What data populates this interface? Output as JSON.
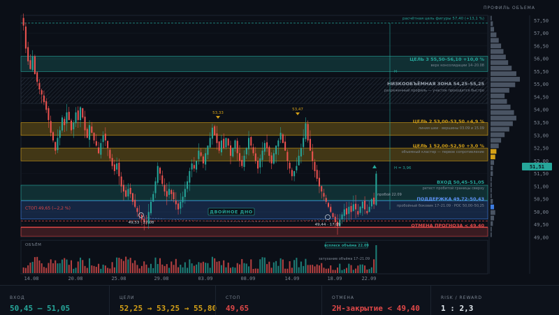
{
  "header": {
    "profile_title": "ПРОФИЛЬ ОБЪЕМА"
  },
  "colors": {
    "bull": "#26a69a",
    "bear": "#ef5350",
    "target": "#d4a017",
    "entry": "#26a69a",
    "support": "#3d7be0",
    "stop": "#e04848",
    "current_price": "#26a69a"
  },
  "y_axis": {
    "ticks": [
      "57,50",
      "57,00",
      "56,50",
      "56,00",
      "55,50",
      "55,00",
      "54,50",
      "54,00",
      "53,50",
      "53,00",
      "52,50",
      "52,00",
      "51,50",
      "51,00",
      "50,50",
      "50,00",
      "49,50",
      "49,00"
    ],
    "current_price_label": "51,51"
  },
  "x_axis": {
    "ticks": [
      "14.08",
      "20.08",
      "25.08",
      "29.08",
      "03.09",
      "08.09",
      "14.09",
      "18.09",
      "22.09"
    ]
  },
  "zones": {
    "target_figure": "расчётная цель фигуры 57,40 (+13,1 %)",
    "target3_title": "ЦЕЛЬ 3 55,50–56,10 +10,0 %",
    "target3_sub": "верх консолидации 14–20.08",
    "lowvol_title": "НИЗКООБЪЁМНАЯ ЗОНА 54,25–55,25",
    "lowvol_sub": "разреженный профиль — участок проходится быстро",
    "target2_title": "ЦЕЛЬ 2 53,00–53,50 +4,9 %",
    "target2_sub": "линия шеи · вершины 03.09 и 15.09",
    "target1_title": "ЦЕЛЬ 1 52,00–52,50 +3,0 %",
    "target1_sub": "объемный кластер — первое сопротивление",
    "entry_title": "ВХОД 50,45–51,05",
    "entry_sub": "ретест пробитой границы сверху",
    "support_title": "ПОДДЕРЖКА 49,72–50,43",
    "support_sub": "пробойный боковик 17–21.09 · POC 50,00–50,25",
    "stop_label": "СТОП 49,65 (−2,2 %)",
    "cancel_label": "ОТМЕНА ПРОГНОЗА < 49,40"
  },
  "annotations": {
    "peak1": "53,33",
    "peak2": "53,47",
    "double_bottom": "ДВОЙНОЕ ДНО",
    "bottom1": "49,53 · 27.08",
    "bottom2": "49,44 · 17.09",
    "h_label": "H = 3,96",
    "h_top": "H",
    "breakout": "пробой 22.09",
    "volume_title": "ОБЪЁМ",
    "volume_spike": "всплеск объёма 22.09",
    "volume_fade": "затухание объёма 17–21.09"
  },
  "chart_data": {
    "type": "candlestick",
    "ylim": [
      49.0,
      57.7
    ],
    "close_series": [
      57.3,
      56.4,
      55.9,
      55.6,
      56.1,
      55.4,
      55.1,
      54.8,
      54.6,
      54.3,
      54.0,
      53.6,
      53.1,
      52.8,
      52.4,
      52.9,
      53.2,
      53.7,
      53.4,
      53.9,
      53.6,
      53.2,
      53.5,
      53.9,
      53.6,
      54.1,
      53.7,
      53.2,
      52.9,
      53.4,
      53.1,
      52.8,
      52.6,
      52.3,
      52.7,
      53.0,
      52.8,
      52.5,
      52.1,
      51.8,
      51.6,
      51.9,
      51.4,
      51.0,
      50.8,
      50.6,
      50.9,
      50.7,
      50.4,
      50.2,
      50.0,
      49.9,
      49.7,
      49.6,
      49.55,
      50.0,
      50.4,
      50.7,
      51.2,
      51.8,
      51.5,
      51.1,
      50.8,
      50.6,
      50.9,
      50.7,
      50.5,
      50.3,
      50.1,
      50.4,
      50.6,
      50.9,
      51.2,
      51.6,
      51.9,
      51.7,
      52.0,
      52.4,
      52.2,
      51.9,
      52.3,
      52.6,
      52.9,
      53.3,
      53.0,
      52.7,
      52.4,
      52.8,
      52.5,
      52.9,
      52.6,
      52.2,
      52.5,
      52.8,
      52.3,
      52.0,
      51.8,
      52.2,
      52.5,
      52.9,
      52.6,
      52.3,
      52.0,
      51.7,
      52.1,
      52.4,
      52.7,
      52.5,
      52.2,
      51.9,
      52.3,
      52.6,
      52.8,
      53.1,
      52.7,
      52.4,
      52.0,
      51.7,
      51.4,
      51.6,
      51.8,
      52.2,
      52.5,
      52.9,
      53.47,
      52.8,
      52.4,
      52.0,
      51.6,
      51.3,
      51.0,
      50.8,
      50.6,
      50.4,
      50.2,
      50.0,
      49.8,
      49.6,
      49.44,
      49.7,
      49.9,
      50.1,
      49.9,
      50.2,
      50.0,
      50.3,
      50.1,
      49.9,
      50.2,
      50.4,
      50.1,
      49.95,
      50.2,
      50.5,
      50.3,
      51.5
    ],
    "volume_profile": [
      1,
      1,
      2,
      3,
      4,
      3,
      2,
      1,
      1,
      1,
      1,
      2,
      2,
      3,
      4,
      5,
      7,
      9,
      12,
      16,
      19,
      22,
      20,
      17,
      14,
      12,
      16,
      21,
      25,
      22,
      18,
      15,
      13,
      11,
      9,
      7,
      5,
      3,
      2,
      1
    ]
  },
  "footer": {
    "entry_label": "ВХОД",
    "entry_value": "50,45 — 51,05",
    "targets_label": "ЦЕЛИ",
    "targets_value": "52,25 → 53,25 → 55,80",
    "stop_label": "СТОП",
    "stop_value": "49,65",
    "cancel_label": "ОТМЕНА",
    "cancel_value": "2Н-закрытие < 49,40",
    "rr_label": "RISK / REWARD",
    "rr_value": "1 : 2,3"
  }
}
